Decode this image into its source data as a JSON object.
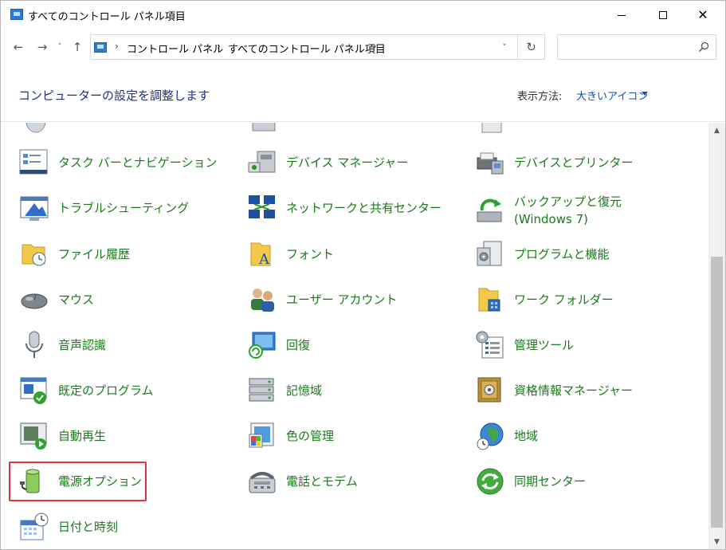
{
  "window": {
    "title": "すべてのコントロール パネル項目",
    "minimize_glyph": "",
    "close_glyph": "✕"
  },
  "nav": {
    "back_glyph": "←",
    "forward_glyph": "→",
    "recent_glyph": "˅",
    "up_glyph": "↑",
    "breadcrumb": [
      {
        "label": "コントロール パネル"
      },
      {
        "label": "すべてのコントロール パネル項目"
      }
    ],
    "separator": "›",
    "dropdown_glyph": "˅",
    "refresh_glyph": "↻",
    "search_placeholder": ""
  },
  "header": {
    "title": "コンピューターの設定を調整します",
    "view_label": "表示方法:",
    "view_value": "大きいアイコン"
  },
  "items": [
    {
      "label": "タスク バーとナビゲーション",
      "icon": "taskbar-icon"
    },
    {
      "label": "デバイス マネージャー",
      "icon": "device-manager-icon"
    },
    {
      "label": "デバイスとプリンター",
      "icon": "devices-printers-icon"
    },
    {
      "label": "トラブルシューティング",
      "icon": "troubleshooting-icon"
    },
    {
      "label": "ネットワークと共有センター",
      "icon": "network-icon"
    },
    {
      "label": "バックアップと復元 (Windows 7)",
      "icon": "backup-icon"
    },
    {
      "label": "ファイル履歴",
      "icon": "file-history-icon"
    },
    {
      "label": "フォント",
      "icon": "fonts-icon"
    },
    {
      "label": "プログラムと機能",
      "icon": "programs-icon"
    },
    {
      "label": "マウス",
      "icon": "mouse-icon"
    },
    {
      "label": "ユーザー アカウント",
      "icon": "user-accounts-icon"
    },
    {
      "label": "ワーク フォルダー",
      "icon": "work-folders-icon"
    },
    {
      "label": "音声認識",
      "icon": "microphone-icon"
    },
    {
      "label": "回復",
      "icon": "recovery-icon"
    },
    {
      "label": "管理ツール",
      "icon": "admin-tools-icon"
    },
    {
      "label": "既定のプログラム",
      "icon": "default-programs-icon"
    },
    {
      "label": "記憶域",
      "icon": "storage-icon"
    },
    {
      "label": "資格情報マネージャー",
      "icon": "credential-manager-icon"
    },
    {
      "label": "自動再生",
      "icon": "autoplay-icon"
    },
    {
      "label": "色の管理",
      "icon": "color-management-icon"
    },
    {
      "label": "地域",
      "icon": "region-icon"
    },
    {
      "label": "電源オプション",
      "icon": "power-options-icon",
      "highlighted": true
    },
    {
      "label": "電話とモデム",
      "icon": "phone-modem-icon"
    },
    {
      "label": "同期センター",
      "icon": "sync-center-icon"
    },
    {
      "label": "日付と時刻",
      "icon": "date-time-icon"
    }
  ],
  "colors": {
    "label_green": "#1a7a1a",
    "header_blue": "#1e3287",
    "link_blue": "#0a52b5",
    "highlight_red": "#e0303a"
  }
}
